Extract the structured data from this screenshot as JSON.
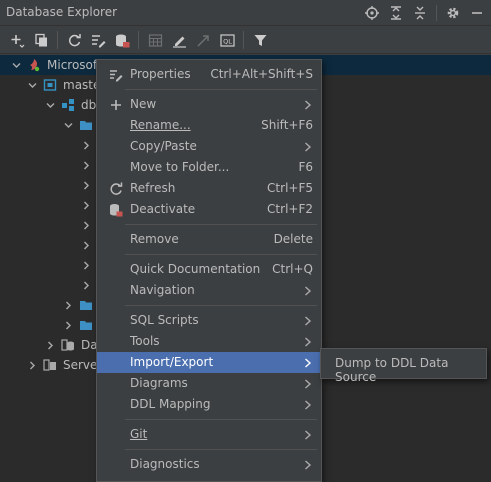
{
  "window": {
    "title": "Database Explorer"
  },
  "tree": {
    "rows": [
      {
        "label": "Microsof"
      },
      {
        "label": "maste"
      },
      {
        "label": "db"
      },
      {
        "label": ""
      },
      {
        "label": "Da"
      },
      {
        "label": "Server"
      }
    ]
  },
  "context_menu": {
    "properties": {
      "label": "Properties",
      "shortcut": "Ctrl+Alt+Shift+S"
    },
    "new": {
      "label": "New"
    },
    "rename": {
      "label": "Rename...",
      "shortcut": "Shift+F6"
    },
    "copy_paste": {
      "label": "Copy/Paste"
    },
    "move_to_folder": {
      "label": "Move to Folder...",
      "shortcut": "F6"
    },
    "refresh": {
      "label": "Refresh",
      "shortcut": "Ctrl+F5"
    },
    "deactivate": {
      "label": "Deactivate",
      "shortcut": "Ctrl+F2"
    },
    "remove": {
      "label": "Remove",
      "shortcut": "Delete"
    },
    "quick_documentation": {
      "label": "Quick Documentation",
      "shortcut": "Ctrl+Q"
    },
    "navigation": {
      "label": "Navigation"
    },
    "sql_scripts": {
      "label": "SQL Scripts"
    },
    "tools": {
      "label": "Tools"
    },
    "import_export": {
      "label": "Import/Export"
    },
    "diagrams": {
      "label": "Diagrams"
    },
    "ddl_mapping": {
      "label": "DDL Mapping"
    },
    "git": {
      "label": "Git"
    },
    "diagnostics": {
      "label": "Diagnostics"
    }
  },
  "submenu": {
    "dump_to_ddl": {
      "label": "Dump to DDL Data Source"
    }
  },
  "colors": {
    "accent": "#4b6eaf",
    "tree_bg": "#2b2b2b",
    "panel_bg": "#3c3f41",
    "selection": "#0d293e"
  }
}
